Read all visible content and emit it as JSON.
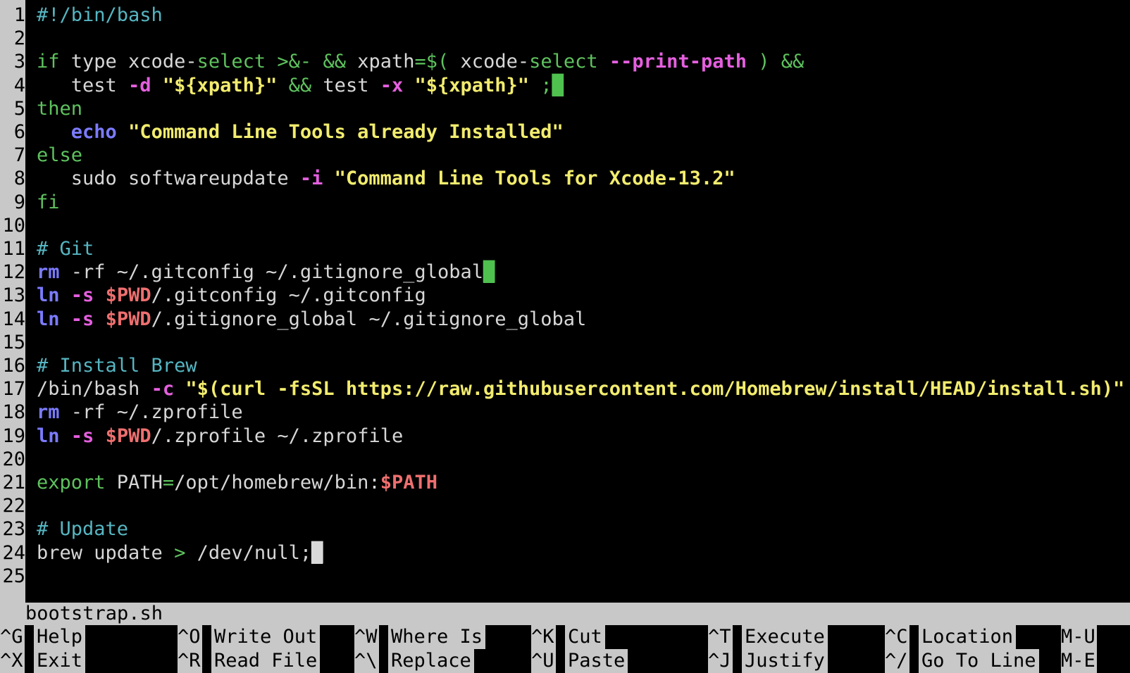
{
  "editor": {
    "filename": "bootstrap.sh",
    "colors": {
      "background": "#000000",
      "gutter": "#c8c8c8",
      "comment": "#56b6c2",
      "keyword": "#5ec25e",
      "option": "#e55fdf",
      "string": "#f2ec6e",
      "builtin": "#7b7bff",
      "variable": "#ef6f6f"
    },
    "lines": [
      {
        "n": "1",
        "tokens": [
          {
            "t": "#!/bin/bash",
            "c": "comment"
          }
        ]
      },
      {
        "n": "2",
        "tokens": []
      },
      {
        "n": "3",
        "tokens": [
          {
            "t": "if",
            "c": "keyword"
          },
          {
            "t": " type xcode-",
            "c": "plain"
          },
          {
            "t": "select",
            "c": "keyword"
          },
          {
            "t": " ",
            "c": "plain"
          },
          {
            "t": ">&-",
            "c": "op"
          },
          {
            "t": " ",
            "c": "plain"
          },
          {
            "t": "&&",
            "c": "op"
          },
          {
            "t": " xpath",
            "c": "plain"
          },
          {
            "t": "=$(",
            "c": "op"
          },
          {
            "t": " xcode-",
            "c": "plain"
          },
          {
            "t": "select",
            "c": "keyword"
          },
          {
            "t": " ",
            "c": "plain"
          },
          {
            "t": "--print-path",
            "c": "opt"
          },
          {
            "t": " ",
            "c": "plain"
          },
          {
            "t": ")",
            "c": "op"
          },
          {
            "t": " ",
            "c": "plain"
          },
          {
            "t": "&&",
            "c": "op"
          }
        ]
      },
      {
        "n": "4",
        "tokens": [
          {
            "t": "   test ",
            "c": "plain"
          },
          {
            "t": "-d",
            "c": "opt"
          },
          {
            "t": " ",
            "c": "plain"
          },
          {
            "t": "\"${xpath}\"",
            "c": "string"
          },
          {
            "t": " ",
            "c": "plain"
          },
          {
            "t": "&&",
            "c": "op"
          },
          {
            "t": " test ",
            "c": "plain"
          },
          {
            "t": "-x",
            "c": "opt"
          },
          {
            "t": " ",
            "c": "plain"
          },
          {
            "t": "\"${xpath}\"",
            "c": "string"
          },
          {
            "t": " ",
            "c": "plain"
          },
          {
            "t": ";",
            "c": "op"
          },
          {
            "t": "█",
            "c": "cursor-green"
          }
        ]
      },
      {
        "n": "5",
        "tokens": [
          {
            "t": "then",
            "c": "keyword"
          }
        ]
      },
      {
        "n": "6",
        "tokens": [
          {
            "t": "   ",
            "c": "plain"
          },
          {
            "t": "echo",
            "c": "builtin"
          },
          {
            "t": " ",
            "c": "plain"
          },
          {
            "t": "\"Command Line Tools already Installed\"",
            "c": "string"
          }
        ]
      },
      {
        "n": "7",
        "tokens": [
          {
            "t": "else",
            "c": "keyword"
          }
        ]
      },
      {
        "n": "8",
        "tokens": [
          {
            "t": "   sudo softwareupdate ",
            "c": "plain"
          },
          {
            "t": "-i",
            "c": "opt"
          },
          {
            "t": " ",
            "c": "plain"
          },
          {
            "t": "\"Command Line Tools for Xcode-13.2\"",
            "c": "string"
          }
        ]
      },
      {
        "n": "9",
        "tokens": [
          {
            "t": "fi",
            "c": "keyword"
          }
        ]
      },
      {
        "n": "10",
        "tokens": []
      },
      {
        "n": "11",
        "tokens": [
          {
            "t": "# Git",
            "c": "comment"
          }
        ]
      },
      {
        "n": "12",
        "tokens": [
          {
            "t": "rm",
            "c": "builtin"
          },
          {
            "t": " -rf ~/.gitconfig ~/.gitignore_global",
            "c": "plain"
          },
          {
            "t": "█",
            "c": "cursor-green"
          }
        ]
      },
      {
        "n": "13",
        "tokens": [
          {
            "t": "ln",
            "c": "builtin"
          },
          {
            "t": " ",
            "c": "plain"
          },
          {
            "t": "-s",
            "c": "opt"
          },
          {
            "t": " ",
            "c": "plain"
          },
          {
            "t": "$PWD",
            "c": "var"
          },
          {
            "t": "/.gitconfig ~/.gitconfig",
            "c": "plain"
          }
        ]
      },
      {
        "n": "14",
        "tokens": [
          {
            "t": "ln",
            "c": "builtin"
          },
          {
            "t": " ",
            "c": "plain"
          },
          {
            "t": "-s",
            "c": "opt"
          },
          {
            "t": " ",
            "c": "plain"
          },
          {
            "t": "$PWD",
            "c": "var"
          },
          {
            "t": "/.gitignore_global ~/.gitignore_global",
            "c": "plain"
          }
        ]
      },
      {
        "n": "15",
        "tokens": []
      },
      {
        "n": "16",
        "tokens": [
          {
            "t": "# Install Brew",
            "c": "comment"
          }
        ]
      },
      {
        "n": "17",
        "tokens": [
          {
            "t": "/bin/bash ",
            "c": "plain"
          },
          {
            "t": "-c",
            "c": "opt"
          },
          {
            "t": " ",
            "c": "plain"
          },
          {
            "t": "\"$(curl -fsSL https://raw.githubusercontent.com/Homebrew/install/HEAD/install.sh)\"",
            "c": "string"
          }
        ]
      },
      {
        "n": "18",
        "tokens": [
          {
            "t": "rm",
            "c": "builtin"
          },
          {
            "t": " -rf ~/.zprofile",
            "c": "plain"
          }
        ]
      },
      {
        "n": "19",
        "tokens": [
          {
            "t": "ln",
            "c": "builtin"
          },
          {
            "t": " ",
            "c": "plain"
          },
          {
            "t": "-s",
            "c": "opt"
          },
          {
            "t": " ",
            "c": "plain"
          },
          {
            "t": "$PWD",
            "c": "var"
          },
          {
            "t": "/.zprofile ~/.zprofile",
            "c": "plain"
          }
        ]
      },
      {
        "n": "20",
        "tokens": []
      },
      {
        "n": "21",
        "tokens": [
          {
            "t": "export",
            "c": "keyword"
          },
          {
            "t": " PATH",
            "c": "plain"
          },
          {
            "t": "=",
            "c": "op"
          },
          {
            "t": "/opt/homebrew/bin:",
            "c": "plain"
          },
          {
            "t": "$PATH",
            "c": "var"
          }
        ]
      },
      {
        "n": "22",
        "tokens": []
      },
      {
        "n": "23",
        "tokens": [
          {
            "t": "# Update",
            "c": "comment"
          }
        ]
      },
      {
        "n": "24",
        "tokens": [
          {
            "t": "brew update ",
            "c": "plain"
          },
          {
            "t": ">",
            "c": "op"
          },
          {
            "t": " /dev/null;",
            "c": "plain"
          },
          {
            "t": "█",
            "c": "cursor-white"
          }
        ]
      },
      {
        "n": "25",
        "tokens": []
      }
    ]
  },
  "shortcuts": {
    "row1": [
      {
        "key": "^G",
        "label": "Help"
      },
      {
        "key": "^O",
        "label": "Write Out"
      },
      {
        "key": "^W",
        "label": "Where Is"
      },
      {
        "key": "^K",
        "label": "Cut"
      },
      {
        "key": "^T",
        "label": "Execute"
      },
      {
        "key": "^C",
        "label": "Location"
      },
      {
        "key": "M-U",
        "label": ""
      }
    ],
    "row2": [
      {
        "key": "^X",
        "label": "Exit"
      },
      {
        "key": "^R",
        "label": "Read File"
      },
      {
        "key": "^\\",
        "label": "Replace"
      },
      {
        "key": "^U",
        "label": "Paste"
      },
      {
        "key": "^J",
        "label": "Justify"
      },
      {
        "key": "^/",
        "label": "Go To Line"
      },
      {
        "key": "M-E",
        "label": ""
      }
    ]
  }
}
